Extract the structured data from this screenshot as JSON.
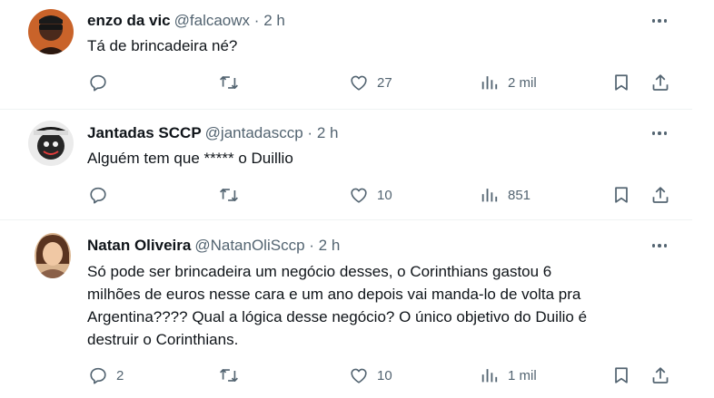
{
  "tweets": [
    {
      "author": "enzo da vic",
      "handle": "@falcaowx",
      "time": "2 h",
      "text": "Tá de brincadeira né?",
      "replies": "",
      "reposts": "",
      "likes": "27",
      "views": "2 mil"
    },
    {
      "author": "Jantadas SCCP",
      "handle": "@jantadasccp",
      "time": "2 h",
      "text": "Alguém tem que ***** o Duillio",
      "replies": "",
      "reposts": "",
      "likes": "10",
      "views": "851"
    },
    {
      "author": "Natan Oliveira",
      "handle": "@NatanOliSccp",
      "time": "2 h",
      "text": "Só pode ser brincadeira um negócio desses, o Corinthians gastou 6 milhões de euros nesse cara e um ano depois vai manda-lo de volta pra Argentina???? Qual a lógica desse negócio? O único objetivo do Duilio é destruir o Corinthians.",
      "replies": "2",
      "reposts": "",
      "likes": "10",
      "views": "1 mil"
    }
  ],
  "separator": "·",
  "icons": [
    "reply-icon",
    "repost-icon",
    "like-icon",
    "views-icon",
    "bookmark-icon",
    "share-icon",
    "more-icon"
  ],
  "colors": {
    "text": "#0f1419",
    "secondary": "#536471",
    "divider": "#eff3f4"
  }
}
